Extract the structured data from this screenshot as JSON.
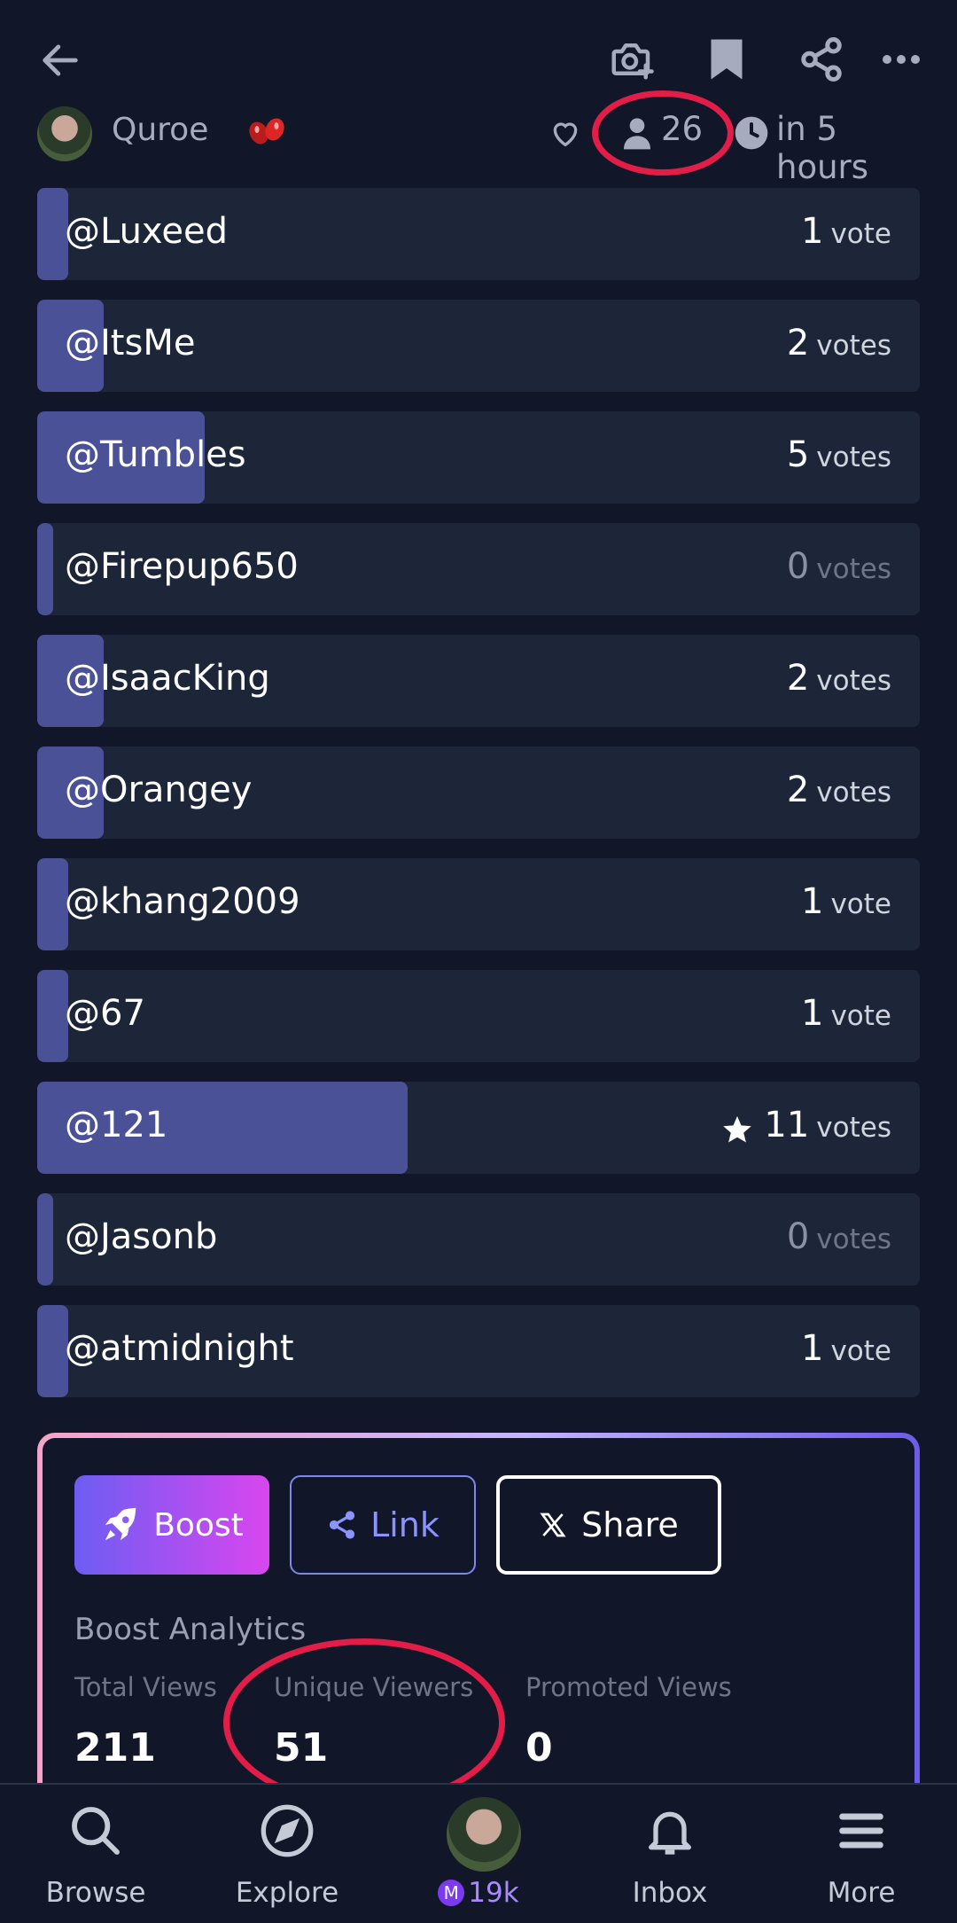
{
  "header": {
    "author_name": "Quroe",
    "bettor_count": "26",
    "closes_text": "in 5 hours"
  },
  "icons": {
    "back": "back-arrow-icon",
    "add_image": "camera-plus-icon",
    "bookmark": "bookmark-icon",
    "share": "share-icon",
    "more": "more-horizontal-icon",
    "like": "heart-icon",
    "bettors": "person-icon",
    "clock": "clock-icon"
  },
  "answers": [
    {
      "name": "@Luxeed",
      "count": "1",
      "unit": "vote",
      "fill": 0.035,
      "zero": false,
      "winner": false
    },
    {
      "name": "@ItsMe",
      "count": "2",
      "unit": "votes",
      "fill": 0.075,
      "zero": false,
      "winner": false
    },
    {
      "name": "@Tumbles",
      "count": "5",
      "unit": "votes",
      "fill": 0.19,
      "zero": false,
      "winner": false
    },
    {
      "name": "@Firepup650",
      "count": "0",
      "unit": "votes",
      "fill": 0.018,
      "zero": true,
      "winner": false
    },
    {
      "name": "@IsaacKing",
      "count": "2",
      "unit": "votes",
      "fill": 0.075,
      "zero": false,
      "winner": false
    },
    {
      "name": "@Orangey",
      "count": "2",
      "unit": "votes",
      "fill": 0.075,
      "zero": false,
      "winner": false
    },
    {
      "name": "@khang2009",
      "count": "1",
      "unit": "vote",
      "fill": 0.035,
      "zero": false,
      "winner": false
    },
    {
      "name": "@67",
      "count": "1",
      "unit": "vote",
      "fill": 0.035,
      "zero": false,
      "winner": false
    },
    {
      "name": "@121",
      "count": "11",
      "unit": "votes",
      "fill": 0.42,
      "zero": false,
      "winner": true
    },
    {
      "name": "@Jasonb",
      "count": "0",
      "unit": "votes",
      "fill": 0.018,
      "zero": true,
      "winner": false
    },
    {
      "name": "@atmidnight",
      "count": "1",
      "unit": "vote",
      "fill": 0.035,
      "zero": false,
      "winner": false
    }
  ],
  "boost": {
    "boost_label": "Boost",
    "link_label": "Link",
    "share_label": "Share",
    "analytics_title": "Boost Analytics",
    "stats": [
      {
        "label": "Total Views",
        "value": "211"
      },
      {
        "label": "Unique Viewers",
        "value": "51"
      },
      {
        "label": "Promoted Views",
        "value": "0"
      }
    ]
  },
  "nav": {
    "browse": "Browse",
    "explore": "Explore",
    "balance": "19k",
    "inbox": "Inbox",
    "more": "More"
  },
  "colors": {
    "background": "#111729",
    "answer_bg": "#1d2638",
    "answer_fill": "#4b5196",
    "annotation": "#e11d48",
    "accent": "#6d5df3"
  }
}
